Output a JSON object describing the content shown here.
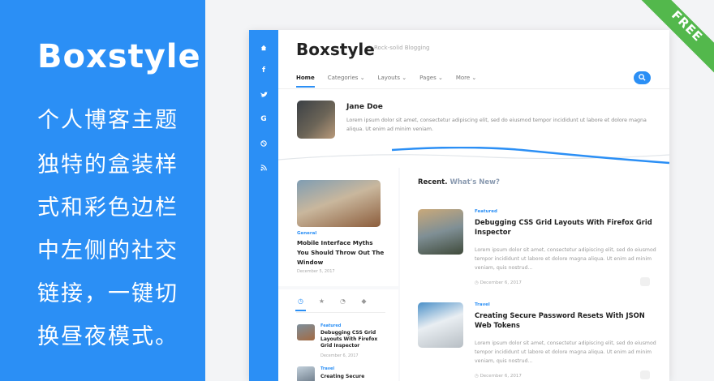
{
  "promo": {
    "title": "Boxstyle",
    "lines": [
      "个人博客主题",
      "独特的盒装样",
      "式和彩色边栏",
      "中左侧的社交",
      "链接，一键切",
      "换昼夜模式。"
    ]
  },
  "ribbon": {
    "label": "FREE"
  },
  "site": {
    "brand": "Boxstyle",
    "tagline": "Rock-solid Blogging",
    "nav": [
      "Home",
      "Categories",
      "Layouts",
      "Pages",
      "More"
    ],
    "social_icons": [
      "home-icon",
      "facebook-icon",
      "twitter-icon",
      "google-icon",
      "dribbble-icon",
      "rss-icon"
    ]
  },
  "author": {
    "name": "Jane Doe",
    "bio": "Lorem ipsum dolor sit amet, consectetur adipiscing elit, sed do eiusmod tempor incididunt ut labore et dolore magna aliqua. Ut enim ad minim veniam."
  },
  "featured_post": {
    "category": "General",
    "title": "Mobile Interface Myths You Should Throw Out The Window",
    "date": "December 5, 2017"
  },
  "recent": {
    "heading": "Recent.",
    "subheading": "What's New?",
    "posts": [
      {
        "category": "Featured",
        "title": "Debugging CSS Grid Layouts With Firefox Grid Inspector",
        "excerpt": "Lorem ipsum dolor sit amet, consectetur adipiscing elit, sed do eiusmod tempor incididunt ut labore et dolore magna aliqua. Ut enim ad minim veniam, quis nostrud...",
        "date": "December 6, 2017"
      },
      {
        "category": "Travel",
        "title": "Creating Secure Password Resets With JSON Web Tokens",
        "excerpt": "Lorem ipsum dolor sit amet, consectetur adipiscing elit, sed do eiusmod tempor incididunt ut labore et dolore magna aliqua. Ut enim ad minim veniam, quis nostrud...",
        "date": "December 6, 2017"
      }
    ]
  },
  "sidebar_tabs": {
    "icons": [
      "clock-icon",
      "star-icon",
      "comments-icon",
      "tags-icon"
    ],
    "items": [
      {
        "category": "Featured",
        "title": "Debugging CSS Grid Layouts With Firefox Grid Inspector",
        "date": "December 6, 2017"
      },
      {
        "category": "Travel",
        "title": "Creating Secure"
      }
    ]
  },
  "colors": {
    "accent": "#2b8ff5",
    "ribbon": "#53b84c"
  }
}
